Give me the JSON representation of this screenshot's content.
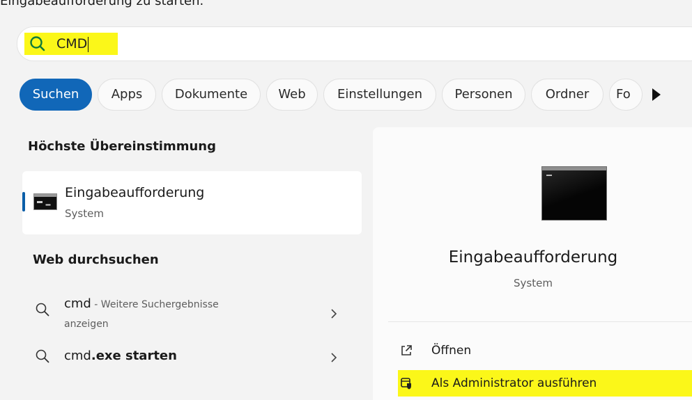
{
  "caption": "Eingabeaufforderung zu starten.",
  "search": {
    "value": "CMD"
  },
  "filters": [
    "Suchen",
    "Apps",
    "Dokumente",
    "Web",
    "Einstellungen",
    "Personen",
    "Ordner",
    "Fo"
  ],
  "best_match": {
    "heading": "Höchste Übereinstimmung",
    "title": "Eingabeaufforderung",
    "subtitle": "System"
  },
  "web": {
    "heading": "Web durchsuchen",
    "items": [
      {
        "strong": "cmd",
        "rest": " - Weitere Suchergebnisse",
        "line2": "anzeigen"
      },
      {
        "pre": "cmd",
        "strong": ".exe starten"
      }
    ]
  },
  "detail": {
    "title": "Eingabeaufforderung",
    "subtitle": "System",
    "actions": [
      "Öffnen",
      "Als Administrator ausführen"
    ]
  },
  "colors": {
    "accent": "#1167b8",
    "highlight": "#fbf719"
  }
}
